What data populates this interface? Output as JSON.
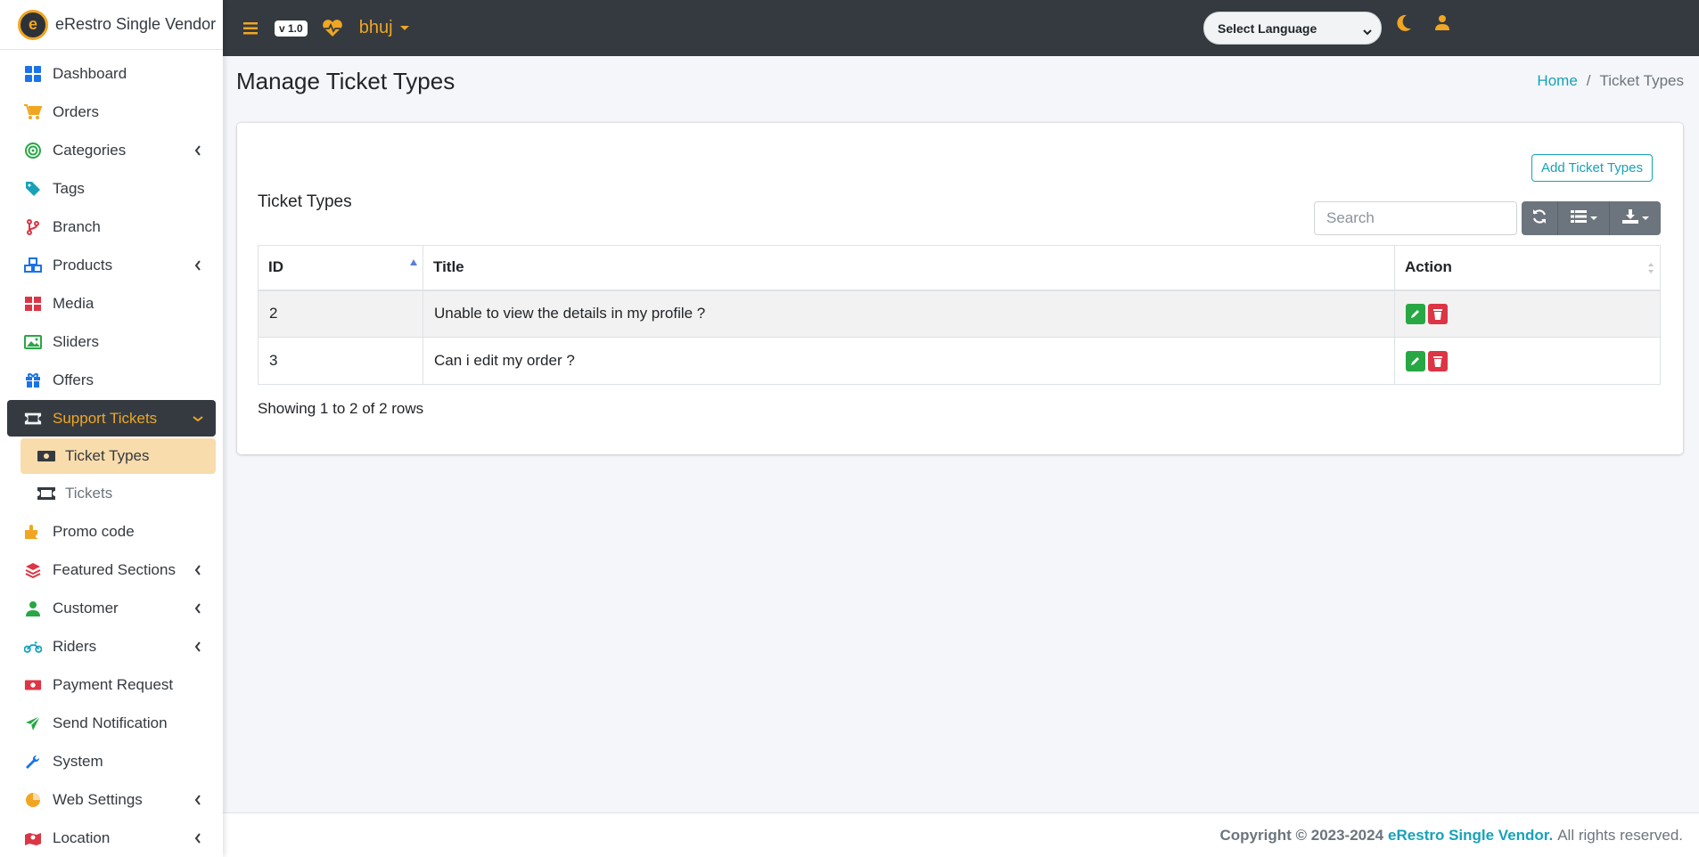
{
  "brand": {
    "logo_letter": "e",
    "name": "eRestro Single Vendor"
  },
  "colors": {
    "accent": "#f0a623",
    "dark": "#343a40",
    "info": "#17a2b8",
    "success": "#28a745",
    "danger": "#dc3545"
  },
  "sidebar": {
    "items": [
      {
        "label": "Dashboard",
        "icon": "dashboard-icon"
      },
      {
        "label": "Orders",
        "icon": "cart-icon"
      },
      {
        "label": "Categories",
        "icon": "target-icon",
        "expandable": true
      },
      {
        "label": "Tags",
        "icon": "tag-icon"
      },
      {
        "label": "Branch",
        "icon": "branch-icon"
      },
      {
        "label": "Products",
        "icon": "cubes-icon",
        "expandable": true
      },
      {
        "label": "Media",
        "icon": "photos-icon"
      },
      {
        "label": "Sliders",
        "icon": "image-icon"
      },
      {
        "label": "Offers",
        "icon": "gift-icon"
      },
      {
        "label": "Support Tickets",
        "icon": "ticket-icon",
        "expandable": true,
        "active": true
      },
      {
        "label": "Promo code",
        "icon": "puzzle-icon"
      },
      {
        "label": "Featured Sections",
        "icon": "layers-icon",
        "expandable": true
      },
      {
        "label": "Customer",
        "icon": "user-icon",
        "expandable": true
      },
      {
        "label": "Riders",
        "icon": "motorcycle-icon",
        "expandable": true
      },
      {
        "label": "Payment Request",
        "icon": "money-icon"
      },
      {
        "label": "Send Notification",
        "icon": "paper-plane-icon"
      },
      {
        "label": "System",
        "icon": "wrench-icon"
      },
      {
        "label": "Web Settings",
        "icon": "chart-pie-icon",
        "expandable": true
      },
      {
        "label": "Location",
        "icon": "map-icon",
        "expandable": true
      }
    ],
    "subitems": [
      {
        "label": "Ticket Types",
        "icon": "money-bill-icon",
        "active": true
      },
      {
        "label": "Tickets",
        "icon": "ticket-icon"
      }
    ]
  },
  "topbar": {
    "version": "v 1.0",
    "user": "bhuj",
    "language_select": "Select Language"
  },
  "page": {
    "title": "Manage Ticket Types",
    "breadcrumb": {
      "home": "Home",
      "separator": "/",
      "current": "Ticket Types"
    }
  },
  "card": {
    "add_button": "Add Ticket Types",
    "heading": "Ticket Types",
    "search_placeholder": "Search",
    "columns": {
      "id": "ID",
      "title": "Title",
      "action": "Action"
    },
    "rows": [
      {
        "id": "2",
        "title": "Unable to view the details in my profile ?"
      },
      {
        "id": "3",
        "title": "Can i edit my order ?"
      }
    ],
    "showing": "Showing 1 to 2 of 2 rows"
  },
  "footer": {
    "copyright": "Copyright © 2023-2024",
    "brand_link": "eRestro Single Vendor.",
    "rights": "All rights reserved."
  }
}
